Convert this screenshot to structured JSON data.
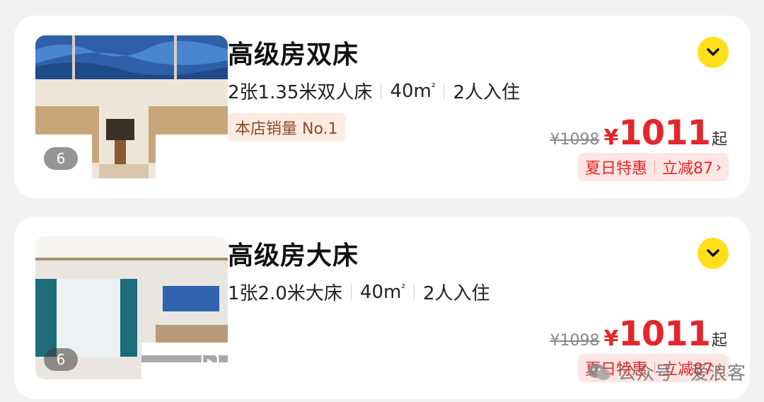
{
  "rooms": [
    {
      "title": "高级房双床",
      "spec_bed": "2张1.35米双人床",
      "spec_area": "40m",
      "spec_area_sup": "²",
      "spec_guests": "2人入住",
      "tag": "本店销量 No.1",
      "photo_count": "6",
      "original_price": "¥1098",
      "currency": "¥",
      "price": "1011",
      "price_suffix": "起",
      "promo_label": "夏日特惠",
      "promo_discount": "立减87",
      "expand_icon": "chevron-down-icon"
    },
    {
      "title": "高级房大床",
      "spec_bed": "1张2.0米大床",
      "spec_area": "40m",
      "spec_area_sup": "²",
      "spec_guests": "2人入住",
      "photo_count": "6",
      "original_price": "¥1098",
      "currency": "¥",
      "price": "1011",
      "price_suffix": "起",
      "promo_label": "夏日特惠",
      "promo_discount": "立减87",
      "expand_icon": "chevron-down-icon"
    }
  ],
  "watermark": {
    "text": "公众号 · 爱浪客"
  },
  "colors": {
    "accent_yellow": "#ffdf1a",
    "price_red": "#e4262b",
    "tag_bg": "#fdebe1"
  }
}
